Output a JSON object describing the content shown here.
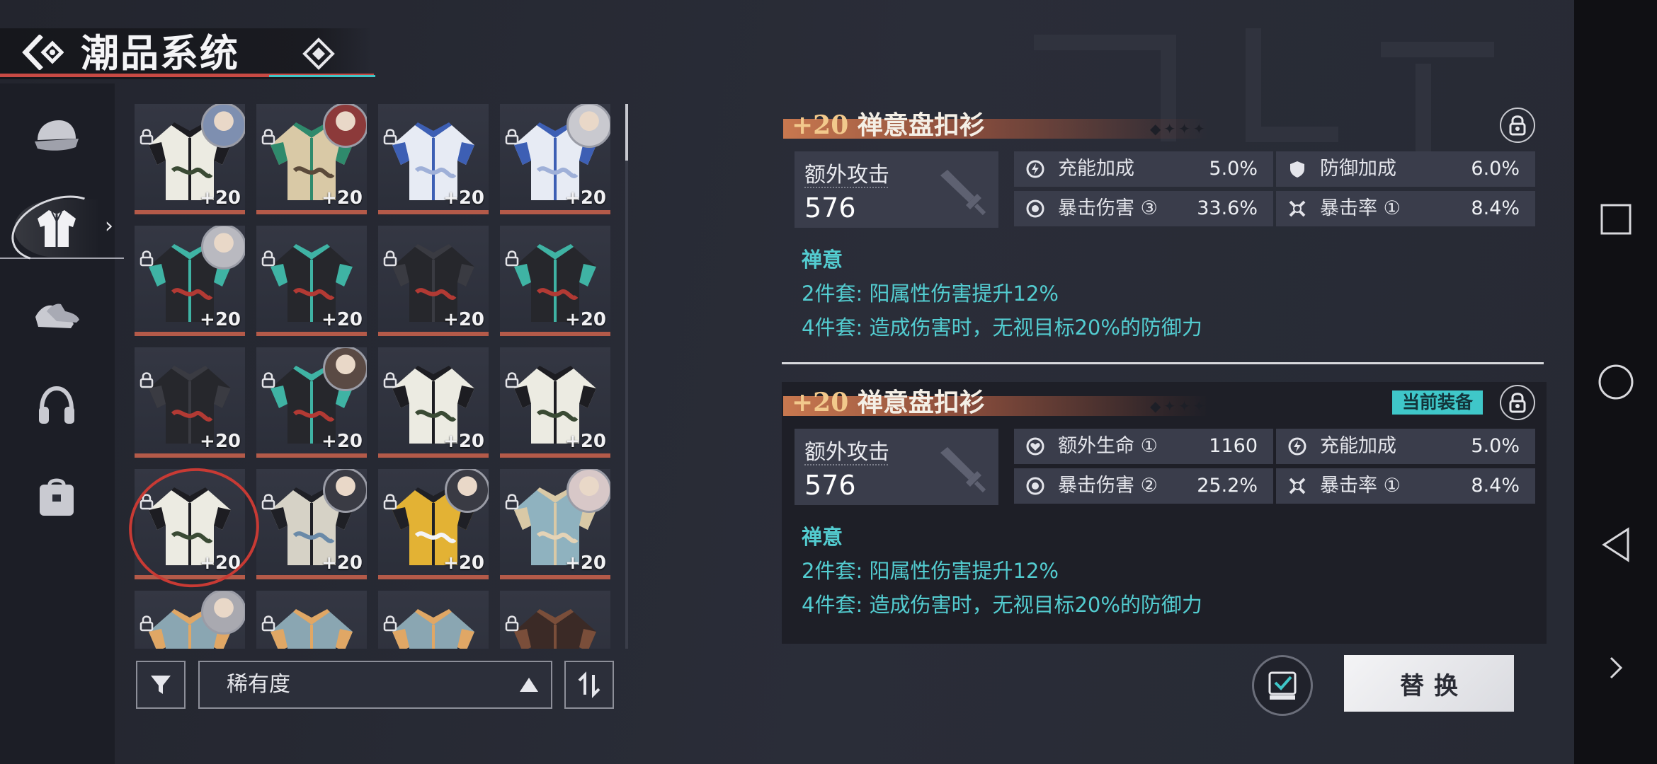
{
  "header": {
    "title": "潮品系统"
  },
  "categories": [
    {
      "icon": "cap-icon"
    },
    {
      "icon": "jacket-icon",
      "active": true
    },
    {
      "icon": "shoes-icon"
    },
    {
      "icon": "headphones-icon"
    },
    {
      "icon": "bag-icon"
    }
  ],
  "grid": {
    "items": [
      {
        "level": "+20",
        "style": "white"
      },
      {
        "level": "+20",
        "style": "parka"
      },
      {
        "level": "+20",
        "style": "blue"
      },
      {
        "level": "+20",
        "style": "blue"
      },
      {
        "level": "+20",
        "style": "dark-teal"
      },
      {
        "level": "+20",
        "style": "dark-teal"
      },
      {
        "level": "+20",
        "style": "dark"
      },
      {
        "level": "+20",
        "style": "dark-teal"
      },
      {
        "level": "+20",
        "style": "dark"
      },
      {
        "level": "+20",
        "style": "dark-teal"
      },
      {
        "level": "+20",
        "style": "white"
      },
      {
        "level": "+20",
        "style": "white"
      },
      {
        "level": "+20",
        "style": "white",
        "selected": true
      },
      {
        "level": "+20",
        "style": "robe"
      },
      {
        "level": "+20",
        "style": "yellow"
      },
      {
        "level": "+20",
        "style": "qipao"
      },
      {
        "level": "",
        "style": "vest"
      },
      {
        "level": "",
        "style": "vest"
      },
      {
        "level": "",
        "style": "vest"
      },
      {
        "level": "",
        "style": "brown"
      }
    ]
  },
  "sort": {
    "label": "稀有度"
  },
  "compare": {
    "level": "+20",
    "name": "禅意盘扣衫",
    "main_stat": {
      "label": "额外攻击",
      "value": "576"
    },
    "sub_stats": [
      {
        "icon": "energy-icon",
        "label": "充能加成",
        "value": "5.0%"
      },
      {
        "icon": "shield-icon",
        "label": "防御加成",
        "value": "6.0%"
      },
      {
        "icon": "crit-dmg-icon",
        "label": "暴击伤害 ③",
        "value": "33.6%"
      },
      {
        "icon": "crit-rate-icon",
        "label": "暴击率 ①",
        "value": "8.4%"
      }
    ],
    "set_name": "禅意",
    "set_effects": [
      "2件套: 阳属性伤害提升12%",
      "4件套: 造成伤害时，无视目标20%的防御力"
    ]
  },
  "current": {
    "level": "+20",
    "name": "禅意盘扣衫",
    "badge": "当前装备",
    "main_stat": {
      "label": "额外攻击",
      "value": "576"
    },
    "sub_stats": [
      {
        "icon": "heart-icon",
        "label": "额外生命 ①",
        "value": "1160"
      },
      {
        "icon": "energy-icon",
        "label": "充能加成",
        "value": "5.0%"
      },
      {
        "icon": "crit-dmg-icon",
        "label": "暴击伤害 ②",
        "value": "25.2%"
      },
      {
        "icon": "crit-rate-icon",
        "label": "暴击率 ①",
        "value": "8.4%"
      }
    ],
    "set_name": "禅意",
    "set_effects": [
      "2件套: 阳属性伤害提升12%",
      "4件套: 造成伤害时，无视目标20%的防御力"
    ]
  },
  "actions": {
    "replace_label": "替换"
  },
  "colors": {
    "accent_cyan": "#53ccd0",
    "accent_red": "#c84a44",
    "badge": "#3fc7c9",
    "level_gold": "#f2c98c"
  }
}
